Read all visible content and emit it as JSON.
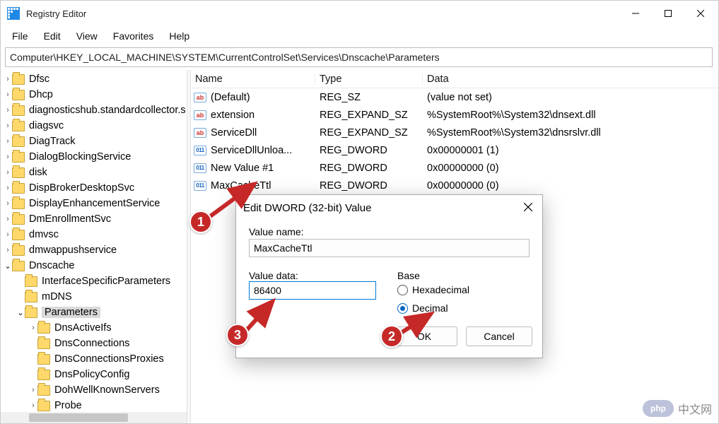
{
  "window": {
    "title": "Registry Editor"
  },
  "menubar": [
    "File",
    "Edit",
    "View",
    "Favorites",
    "Help"
  ],
  "addressbar": "Computer\\HKEY_LOCAL_MACHINE\\SYSTEM\\CurrentControlSet\\Services\\Dnscache\\Parameters",
  "tree": [
    {
      "depth": 1,
      "label": "Dfsc",
      "twisty": ">"
    },
    {
      "depth": 1,
      "label": "Dhcp",
      "twisty": ">"
    },
    {
      "depth": 1,
      "label": "diagnosticshub.standardcollector.s",
      "twisty": ">"
    },
    {
      "depth": 1,
      "label": "diagsvc",
      "twisty": ">"
    },
    {
      "depth": 1,
      "label": "DiagTrack",
      "twisty": ">"
    },
    {
      "depth": 1,
      "label": "DialogBlockingService",
      "twisty": ">"
    },
    {
      "depth": 1,
      "label": "disk",
      "twisty": ">"
    },
    {
      "depth": 1,
      "label": "DispBrokerDesktopSvc",
      "twisty": ">"
    },
    {
      "depth": 1,
      "label": "DisplayEnhancementService",
      "twisty": ">"
    },
    {
      "depth": 1,
      "label": "DmEnrollmentSvc",
      "twisty": ">"
    },
    {
      "depth": 1,
      "label": "dmvsc",
      "twisty": ">"
    },
    {
      "depth": 1,
      "label": "dmwappushservice",
      "twisty": ">"
    },
    {
      "depth": 1,
      "label": "Dnscache",
      "twisty": "v",
      "open": true
    },
    {
      "depth": 2,
      "label": "InterfaceSpecificParameters",
      "twisty": ""
    },
    {
      "depth": 2,
      "label": "mDNS",
      "twisty": ""
    },
    {
      "depth": 2,
      "label": "Parameters",
      "twisty": "v",
      "open": true,
      "selected": true
    },
    {
      "depth": 3,
      "label": "DnsActiveIfs",
      "twisty": ">"
    },
    {
      "depth": 3,
      "label": "DnsConnections",
      "twisty": ""
    },
    {
      "depth": 3,
      "label": "DnsConnectionsProxies",
      "twisty": ""
    },
    {
      "depth": 3,
      "label": "DnsPolicyConfig",
      "twisty": ""
    },
    {
      "depth": 3,
      "label": "DohWellKnownServers",
      "twisty": ">"
    },
    {
      "depth": 3,
      "label": "Probe",
      "twisty": ">"
    }
  ],
  "columns": {
    "name": "Name",
    "type": "Type",
    "data": "Data"
  },
  "rows": [
    {
      "icon": "ab",
      "name": "(Default)",
      "type": "REG_SZ",
      "data": "(value not set)"
    },
    {
      "icon": "ab",
      "name": "extension",
      "type": "REG_EXPAND_SZ",
      "data": "%SystemRoot%\\System32\\dnsext.dll"
    },
    {
      "icon": "ab",
      "name": "ServiceDll",
      "type": "REG_EXPAND_SZ",
      "data": "%SystemRoot%\\System32\\dnsrslvr.dll"
    },
    {
      "icon": "bin",
      "name": "ServiceDllUnloa...",
      "type": "REG_DWORD",
      "data": "0x00000001 (1)"
    },
    {
      "icon": "bin",
      "name": "New Value #1",
      "type": "REG_DWORD",
      "data": "0x00000000 (0)"
    },
    {
      "icon": "bin",
      "name": "MaxCacheTtl",
      "type": "REG_DWORD",
      "data": "0x00000000 (0)"
    }
  ],
  "dialog": {
    "title": "Edit DWORD (32-bit) Value",
    "value_name_label": "Value name:",
    "value_name": "MaxCacheTtl",
    "value_data_label": "Value data:",
    "value_data": "86400",
    "base_label": "Base",
    "hex_label": "Hexadecimal",
    "dec_label": "Decimal",
    "ok": "OK",
    "cancel": "Cancel"
  },
  "callouts": {
    "c1": "1",
    "c2": "2",
    "c3": "3"
  },
  "watermark": {
    "logo": "php",
    "text": "中文网"
  }
}
